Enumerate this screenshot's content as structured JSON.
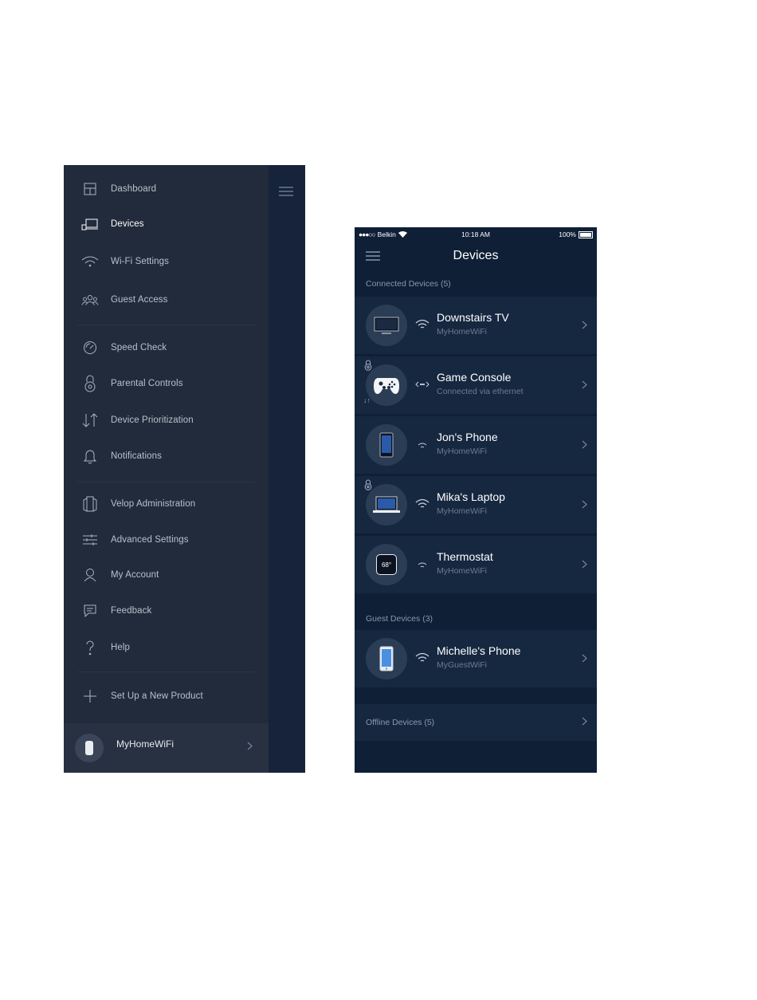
{
  "drawer": {
    "menu": [
      {
        "label": "Dashboard",
        "icon": "dashboard-icon"
      },
      {
        "label": "Devices",
        "icon": "devices-icon",
        "active": true
      },
      {
        "label": "Wi-Fi Settings",
        "icon": "wifi-icon"
      },
      {
        "label": "Guest Access",
        "icon": "guest-icon"
      },
      {
        "label": "Speed Check",
        "icon": "speedometer-icon"
      },
      {
        "label": "Parental Controls",
        "icon": "lock-icon"
      },
      {
        "label": "Device Prioritization",
        "icon": "priority-arrows-icon"
      },
      {
        "label": "Notifications",
        "icon": "bell-icon"
      },
      {
        "label": "Velop Administration",
        "icon": "velop-node-icon"
      },
      {
        "label": "Advanced Settings",
        "icon": "sliders-icon"
      },
      {
        "label": "My Account",
        "icon": "user-icon"
      },
      {
        "label": "Feedback",
        "icon": "chat-bubble-icon"
      },
      {
        "label": "Help",
        "icon": "question-icon"
      },
      {
        "label": "Set Up a New Product",
        "icon": "plus-icon"
      }
    ],
    "network_name": "MyHomeWiFi"
  },
  "phone": {
    "status": {
      "carrier": "Belkin",
      "time": "10:18 AM",
      "battery": "100%"
    },
    "title": "Devices",
    "connected_header": "Connected Devices (5)",
    "connected_devices": [
      {
        "name": "Downstairs TV",
        "network": "MyHomeWiFi",
        "connection": "wifi",
        "icon": "tv-icon"
      },
      {
        "name": "Game Console",
        "network": "Connected via ethernet",
        "connection": "ethernet",
        "icon": "gamepad-icon",
        "parental_lock": true,
        "prioritized": true
      },
      {
        "name": "Jon's Phone",
        "network": "MyHomeWiFi",
        "connection": "wifi",
        "icon": "phone-icon"
      },
      {
        "name": "Mika's Laptop",
        "network": "MyHomeWiFi",
        "connection": "wifi",
        "icon": "laptop-icon",
        "parental_lock": true
      },
      {
        "name": "Thermostat",
        "network": "MyHomeWiFi",
        "connection": "wifi",
        "icon": "thermostat-icon",
        "display_value": "68°"
      }
    ],
    "guest_header": "Guest Devices  (3)",
    "guest_devices": [
      {
        "name": "Michelle's Phone",
        "network": "MyGuestWiFi",
        "connection": "wifi",
        "icon": "phone-icon"
      }
    ],
    "offline_label": "Offline Devices  (5)"
  },
  "colors": {
    "drawer_bg": "#222b3b",
    "phone_bg": "#0f1f36",
    "row_bg": "#162840",
    "accent_text": "#ffffff",
    "muted_text": "#8b97aa"
  }
}
